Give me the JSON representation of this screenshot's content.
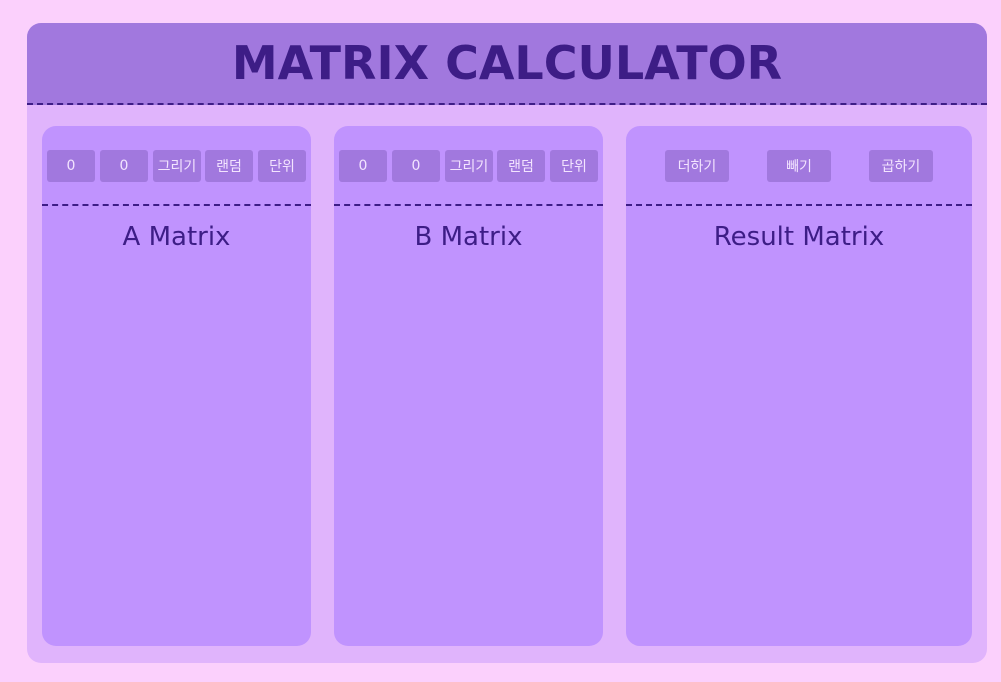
{
  "app": {
    "title": "MATRIX CALCULATOR"
  },
  "panels": {
    "a": {
      "title": "A Matrix",
      "rows_value": "0",
      "cols_value": "0",
      "buttons": {
        "draw": "그리기",
        "random": "랜덤",
        "identity": "단위"
      }
    },
    "b": {
      "title": "B Matrix",
      "rows_value": "0",
      "cols_value": "0",
      "buttons": {
        "draw": "그리기",
        "random": "랜덤",
        "identity": "단위"
      }
    },
    "result": {
      "title": "Result Matrix",
      "buttons": {
        "add": "더하기",
        "subtract": "빼기",
        "multiply": "곱하기"
      }
    }
  },
  "colors": {
    "page_bg": "#fbd0fc",
    "app_bg": "#e0b4fc",
    "header_bg": "#a178de",
    "panel_bg": "#c093fe",
    "button_bg": "#a178de",
    "accent_text": "#3d1d86"
  }
}
